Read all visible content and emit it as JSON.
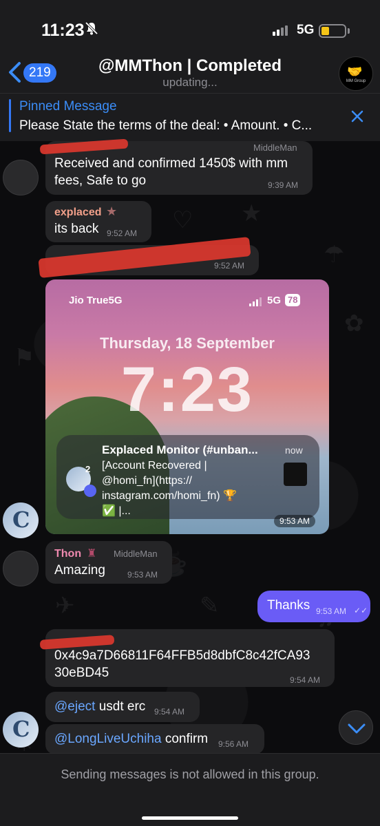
{
  "status_bar": {
    "time": "11:23",
    "network": "5G"
  },
  "header": {
    "back_count": "219",
    "title": "@MMThon | Completed",
    "subtitle": "updating...",
    "group_avatar_label": "MM Group"
  },
  "pinned": {
    "title": "Pinned Message",
    "text": "Please State the terms of the deal: • Amount. • C..."
  },
  "messages": [
    {
      "role": "MiddleMan",
      "text_line1": "Received and confirmed 1450$ with mm",
      "text_line2": "fees, Safe to go",
      "time": "9:39 AM"
    },
    {
      "sender": "explaced",
      "text": "its back",
      "time": "9:52 AM"
    },
    {
      "time": "9:52 AM"
    },
    {
      "time": "9:53 AM"
    },
    {
      "sender": "Thon",
      "role": "MiddleMan",
      "text": "Amazing",
      "time": "9:53 AM"
    },
    {
      "text": "Thanks",
      "time": "9:53 AM"
    },
    {
      "text_line1": "0x4c9a7D66811F64FFB5d8dbfC8c42fCA93",
      "text_line2": "30eBD45",
      "time": "9:54 AM"
    },
    {
      "mention": "@eject",
      "text": " usdt erc",
      "time": "9:54 AM"
    },
    {
      "mention": "@LongLiveUchiha",
      "text": " confirm",
      "time": "9:56 AM"
    }
  ],
  "screenshot": {
    "carrier": "Jio True5G",
    "network": "5G",
    "battery": "78",
    "date": "Thursday, 18 September",
    "clock": "7:23",
    "notification": {
      "title": "Explaced Monitor (#unban...",
      "time": "now",
      "badge": "2",
      "body_line1": "[Account Recovered |",
      "body_line2": "@homi_fn](https://",
      "body_line3": "instagram.com/homi_fn) 🏆",
      "body_line4": "✅ |..."
    }
  },
  "bottom": {
    "notice": "Sending messages is not allowed in this group."
  },
  "colors": {
    "accent": "#3478f6",
    "outgoing": "#6a5cf6",
    "sender_explaced": "#f2a08a",
    "sender_thon": "#f08ab0"
  }
}
